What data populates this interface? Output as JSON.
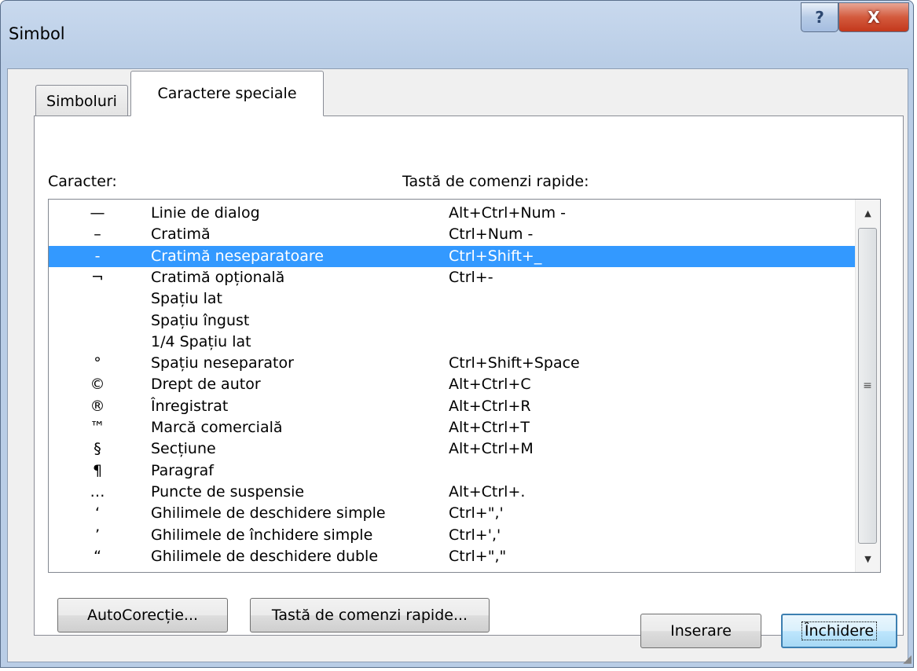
{
  "window": {
    "title": "Simbol",
    "help_label": "?",
    "close_label": "X"
  },
  "tabs": {
    "simboluri": "Simboluri",
    "caractere_speciale": "Caractere speciale"
  },
  "headers": {
    "caracter": "Caracter:",
    "shortcut": "Tastă de comenzi rapide:"
  },
  "rows": [
    {
      "symbol": "—",
      "name": "Linie de dialog",
      "key": "Alt+Ctrl+Num -"
    },
    {
      "symbol": "–",
      "name": "Cratimă",
      "key": "Ctrl+Num -"
    },
    {
      "symbol": "-",
      "name": "Cratimă neseparatoare",
      "key": "Ctrl+Shift+_",
      "selected": true
    },
    {
      "symbol": "¬",
      "name": "Cratimă opțională",
      "key": "Ctrl+-"
    },
    {
      "symbol": "",
      "name": "Spațiu lat",
      "key": ""
    },
    {
      "symbol": "",
      "name": "Spațiu îngust",
      "key": ""
    },
    {
      "symbol": "",
      "name": "1/4 Spațiu lat",
      "key": ""
    },
    {
      "symbol": "°",
      "name": "Spațiu neseparator",
      "key": "Ctrl+Shift+Space"
    },
    {
      "symbol": "©",
      "name": "Drept de autor",
      "key": "Alt+Ctrl+C"
    },
    {
      "symbol": "®",
      "name": "Înregistrat",
      "key": "Alt+Ctrl+R"
    },
    {
      "symbol": "™",
      "name": "Marcă comercială",
      "key": "Alt+Ctrl+T"
    },
    {
      "symbol": "§",
      "name": "Secțiune",
      "key": "Alt+Ctrl+M"
    },
    {
      "symbol": "¶",
      "name": "Paragraf",
      "key": ""
    },
    {
      "symbol": "…",
      "name": "Puncte de suspensie",
      "key": "Alt+Ctrl+."
    },
    {
      "symbol": "‘",
      "name": "Ghilimele de deschidere simple",
      "key": "Ctrl+\",'"
    },
    {
      "symbol": "’",
      "name": "Ghilimele de închidere simple",
      "key": "Ctrl+','"
    },
    {
      "symbol": "“",
      "name": "Ghilimele de deschidere duble",
      "key": "Ctrl+\",\""
    }
  ],
  "buttons": {
    "autocorectie": "AutoCorecție...",
    "tasta": "Tastă de comenzi rapide...",
    "inserare": "Inserare",
    "inchidere": "Închidere"
  },
  "icons": {
    "scroll_up": "scroll-up-arrow-icon",
    "scroll_down": "scroll-down-arrow-icon",
    "thumb_grip": "scroll-thumb-grip-icon",
    "resize": "resize-grip-icon"
  },
  "colors": {
    "selection": "#3399ff",
    "close_button": "#c3381c",
    "default_button_border": "#3c7fb1"
  }
}
